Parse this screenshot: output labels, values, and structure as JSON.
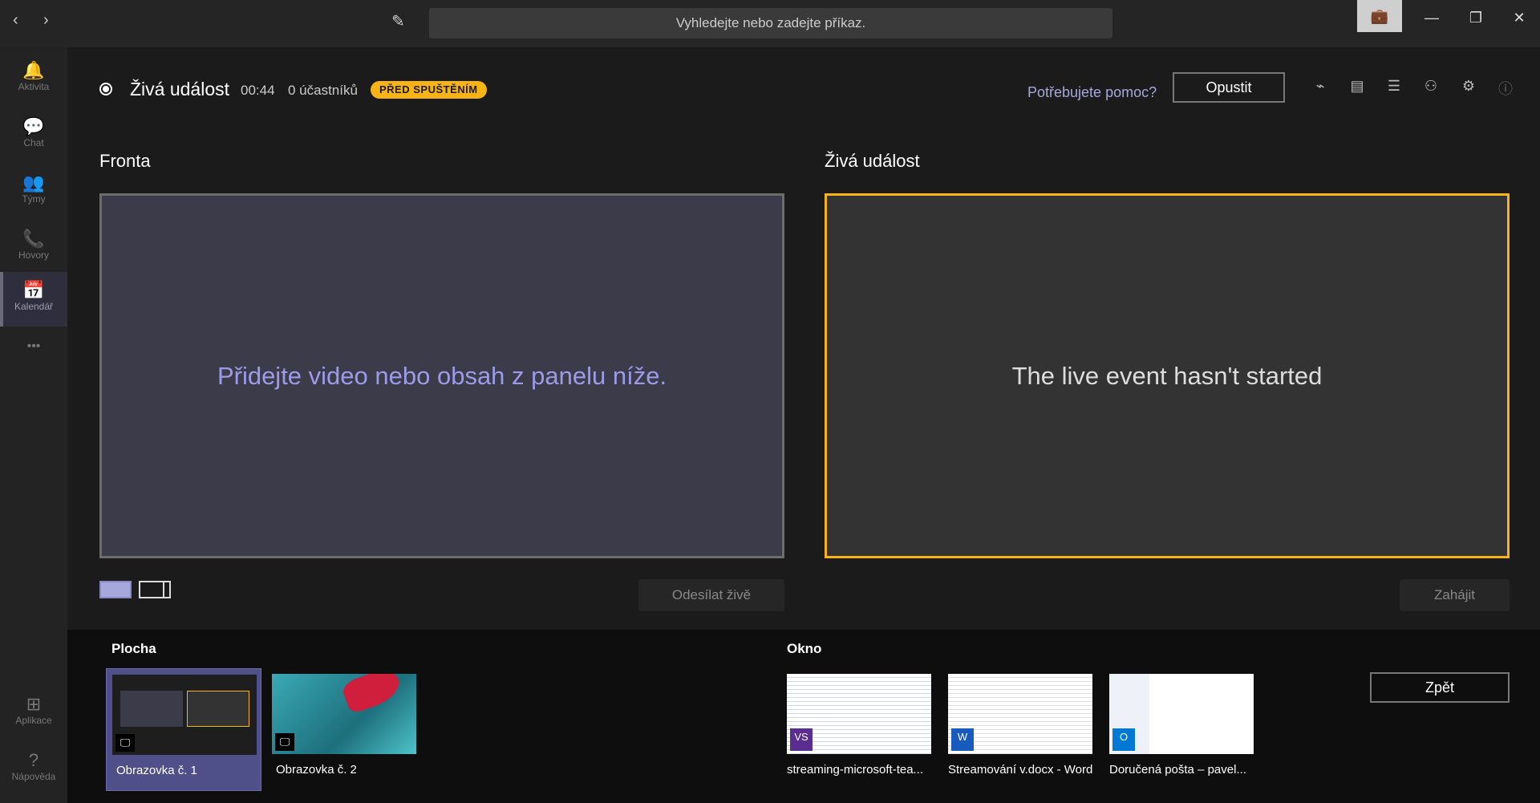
{
  "titlebar": {
    "search_placeholder": "Vyhledejte nebo zadejte příkaz.",
    "back_icon": "‹",
    "forward_icon": "›",
    "compose_icon": "✎",
    "briefcase_icon": "💼",
    "minimize": "—",
    "maximize": "❐",
    "close": "✕"
  },
  "sidebar": {
    "items": [
      {
        "label": "Aktivita",
        "icon": "🔔"
      },
      {
        "label": "Chat",
        "icon": "💬"
      },
      {
        "label": "Týmy",
        "icon": "👥"
      },
      {
        "label": "Hovory",
        "icon": "📞"
      },
      {
        "label": "Kalendář",
        "icon": "📅"
      },
      {
        "label": "Aplikace",
        "icon": "⊞"
      },
      {
        "label": "Nápověda",
        "icon": "?"
      }
    ],
    "more": "•••"
  },
  "header": {
    "title": "Živá událost",
    "timer": "00:44",
    "participants": "0 účastníků",
    "status_badge": "PŘED SPUŠTĚNÍM",
    "help_link": "Potřebujete pomoc?",
    "leave_button": "Opustit",
    "icons": [
      "⌁",
      "▤",
      "☰",
      "⚇",
      "⚙",
      "ⓘ"
    ]
  },
  "queue": {
    "label": "Fronta",
    "message": "Přidejte video nebo obsah z panelu níže.",
    "send_live_button": "Odesílat živě"
  },
  "live": {
    "label": "Živá událost",
    "message": "The live event hasn't started",
    "start_button": "Zahájit"
  },
  "sources": {
    "desktop_label": "Plocha",
    "screens": [
      {
        "label": "Obrazovka č. 1",
        "selected": true
      },
      {
        "label": "Obrazovka č. 2",
        "selected": false
      }
    ],
    "window_label": "Okno",
    "windows": [
      {
        "label": "streaming-microsoft-tea...",
        "app_icon": "VS"
      },
      {
        "label": "Streamování v.docx - Word",
        "app_icon": "W"
      },
      {
        "label": "Doručená pošta – pavel...",
        "app_icon": "O"
      }
    ],
    "back_button": "Zpět"
  },
  "colors": {
    "accent": "#f8b416",
    "brand": "#6264a7",
    "link": "#a6a7dc"
  }
}
